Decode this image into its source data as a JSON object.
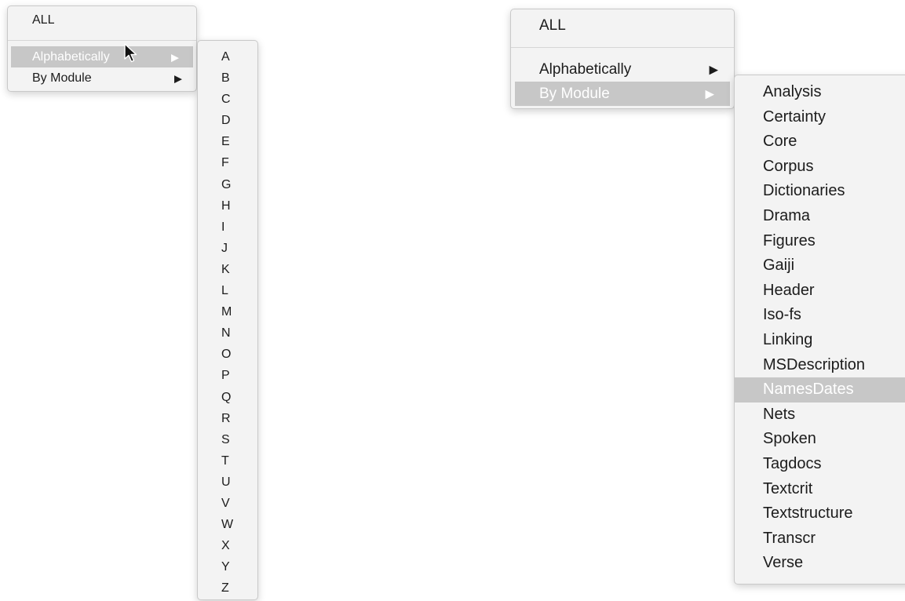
{
  "left_menu": {
    "all_label": "ALL",
    "alphabetically_label": "Alphabetically",
    "by_module_label": "By Module"
  },
  "letters": [
    "A",
    "B",
    "C",
    "D",
    "E",
    "F",
    "G",
    "H",
    "I",
    "J",
    "K",
    "L",
    "M",
    "N",
    "O",
    "P",
    "Q",
    "R",
    "S",
    "T",
    "U",
    "V",
    "W",
    "X",
    "Y",
    "Z"
  ],
  "right_menu": {
    "all_label": "ALL",
    "alphabetically_label": "Alphabetically",
    "by_module_label": "By Module"
  },
  "modules": [
    "Analysis",
    "Certainty",
    "Core",
    "Corpus",
    "Dictionaries",
    "Drama",
    "Figures",
    "Gaiji",
    "Header",
    "Iso-fs",
    "Linking",
    "MSDescription",
    "NamesDates",
    "Nets",
    "Spoken",
    "Tagdocs",
    "Textcrit",
    "Textstructure",
    "Transcr",
    "Verse"
  ],
  "selected_module": "NamesDates",
  "icons": {
    "submenu_arrow": "triangle-right-icon",
    "cursor": "mouse-pointer-icon"
  },
  "colors": {
    "highlight": "#c7c7c7",
    "highlight_text": "#ffffff",
    "menu_background": "#f3f3f3"
  }
}
